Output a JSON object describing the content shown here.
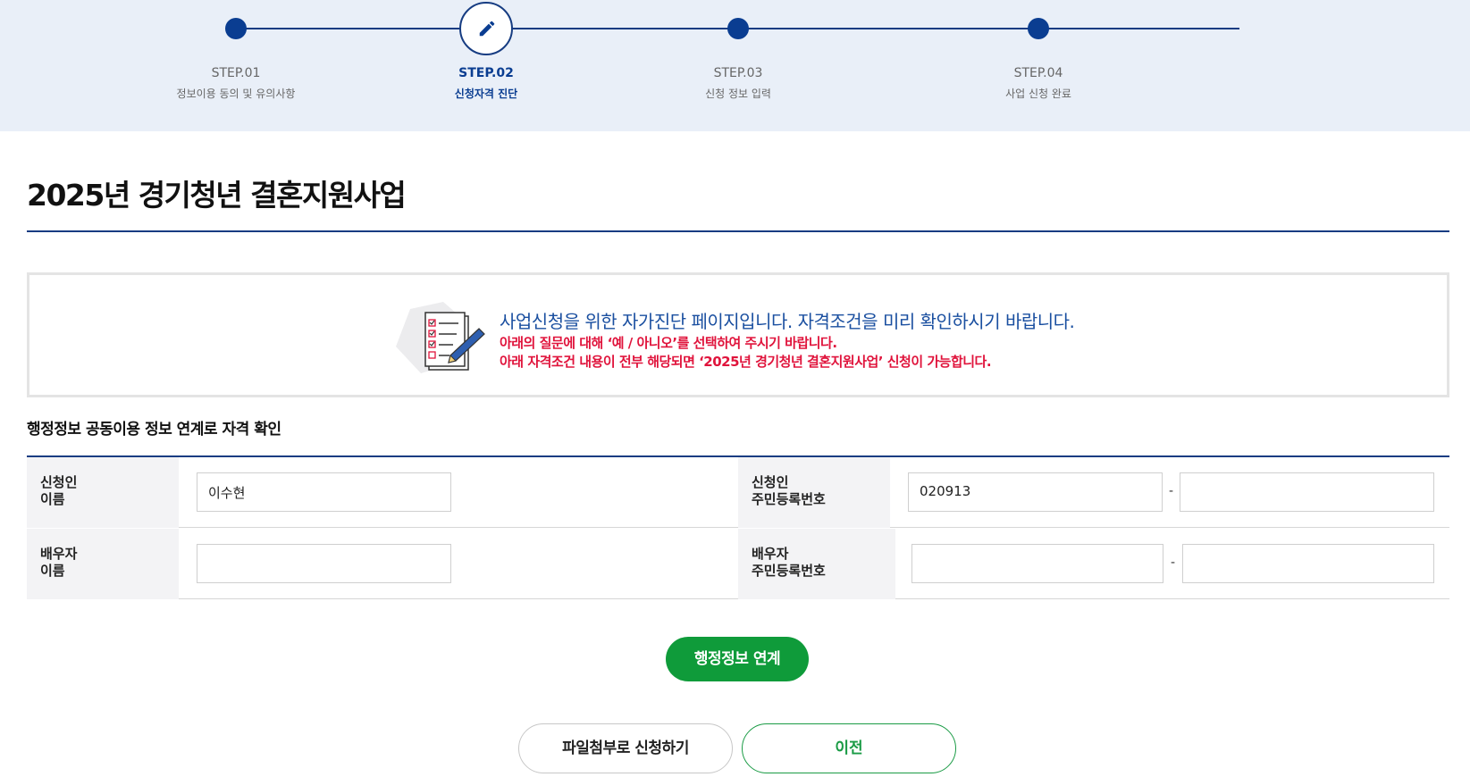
{
  "steps": [
    {
      "num": "STEP.01",
      "desc": "정보이용 동의 및 유의사항",
      "active": false
    },
    {
      "num": "STEP.02",
      "desc": "신청자격 진단",
      "active": true
    },
    {
      "num": "STEP.03",
      "desc": "신청 정보 입력",
      "active": false
    },
    {
      "num": "STEP.04",
      "desc": "사업 신청 완료",
      "active": false
    }
  ],
  "page": {
    "title": "2025년 경기청년 결혼지원사업"
  },
  "notice": {
    "headline": "사업신청을 위한 자가진단 페이지입니다. 자격조건을 미리 확인하시기 바랍니다.",
    "line1": "아래의 질문에 대해 ‘예 / 아니오’를 선택하여 주시기 바랍니다.",
    "line2": "아래 자격조건 내용이 전부 해당되면 ‘2025년 경기청년 결혼지원사업’ 신청이 가능합니다."
  },
  "form": {
    "section_title": "행정정보 공동이용 정보 연계로 자격 확인",
    "applicant_name_label_1": "신청인",
    "applicant_name_label_2": "이름",
    "applicant_name_value": "이수현",
    "applicant_rrn_label_1": "신청인",
    "applicant_rrn_label_2": "주민등록번호",
    "applicant_rrn_front": "020913",
    "applicant_rrn_back": "",
    "spouse_name_label_1": "배우자",
    "spouse_name_label_2": "이름",
    "spouse_name_value": "",
    "spouse_rrn_label_1": "배우자",
    "spouse_rrn_label_2": "주민등록번호",
    "spouse_rrn_front": "",
    "spouse_rrn_back": "",
    "dash": "-"
  },
  "buttons": {
    "link_admin": "행정정보 연계",
    "file_apply": "파일첨부로 신청하기",
    "prev": "이전"
  },
  "colors": {
    "navy": "#0a3d91",
    "green": "#0f9b3a",
    "red": "#e0143c",
    "blue_text": "#1a4fa0",
    "step_bg": "#e9eff8"
  }
}
